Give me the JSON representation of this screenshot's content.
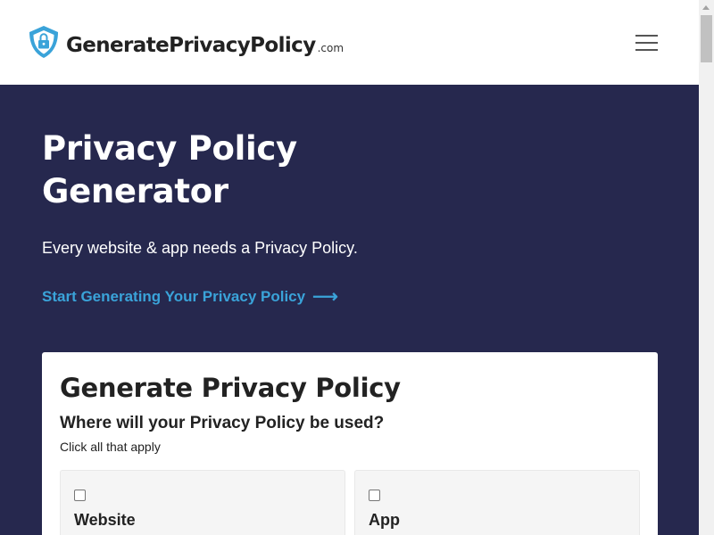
{
  "header": {
    "logo_name": "GeneratePrivacyPolicy",
    "logo_tld": ".com",
    "logo_icon": "shield-lock-icon",
    "menu_icon": "hamburger-menu-icon",
    "brand_color": "#3aa3d9"
  },
  "hero": {
    "title": "Privacy Policy Generator",
    "subtitle": "Every website & app needs a Privacy Policy.",
    "cta_label": "Start Generating Your Privacy Policy",
    "cta_arrow": "⟶",
    "background_color": "#26284e",
    "link_color": "#3aa3d9"
  },
  "card": {
    "title": "Generate Privacy Policy",
    "question": "Where will your Privacy Policy be used?",
    "hint": "Click all that apply",
    "options": [
      {
        "label": "Website",
        "checked": false
      },
      {
        "label": "App",
        "checked": false
      }
    ]
  }
}
